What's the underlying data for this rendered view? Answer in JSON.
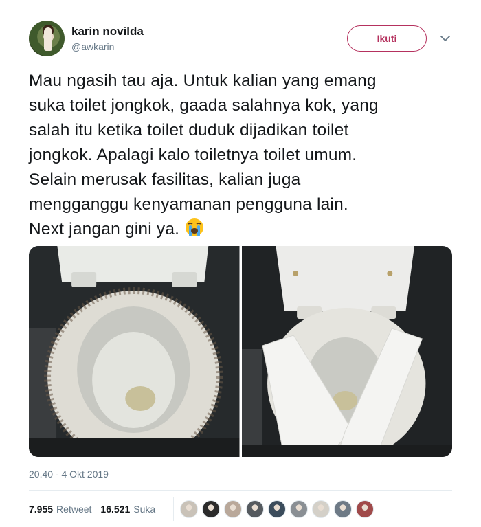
{
  "user": {
    "name": "karin novilda",
    "handle": "@awkarin"
  },
  "follow_button": {
    "label": "Ikuti"
  },
  "menu": {
    "icon": "chevron-down-icon"
  },
  "tweet": {
    "text": "Mau ngasih tau aja. Untuk kalian yang emang\nsuka toilet jongkok, gaada salahnya kok, yang\nsalah itu ketika toilet duduk dijadikan toilet\njongkok. Apalagi kalo toiletnya toilet umum.\nSelain merusak fasilitas, kalian juga\nmengganggu kenyamanan pengguna lain.\nNext jangan gini ya.",
    "emoji": "loudly-crying-face-emoji"
  },
  "photos": [
    {
      "description_icon": "dirty-toilet-photo"
    },
    {
      "description_icon": "toilet-with-tissue-photo"
    }
  ],
  "timestamp": "20.40 - 4 Okt 2019",
  "stats": {
    "retweets": "7.955",
    "retweets_label": "Retweet",
    "likes": "16.521",
    "likes_label": "Suka"
  },
  "likers": [
    {
      "color": "#c9c2b8"
    },
    {
      "color": "#2b2b2b"
    },
    {
      "color": "#b9a89a"
    },
    {
      "color": "#555a5f"
    },
    {
      "color": "#3b4c5c"
    },
    {
      "color": "#8a8f94"
    },
    {
      "color": "#d4d0c8"
    },
    {
      "color": "#6e7a86"
    },
    {
      "color": "#a04a4a"
    }
  ],
  "colors": {
    "accent": "#b5315e",
    "text": "#14171a",
    "secondary": "#657786"
  }
}
